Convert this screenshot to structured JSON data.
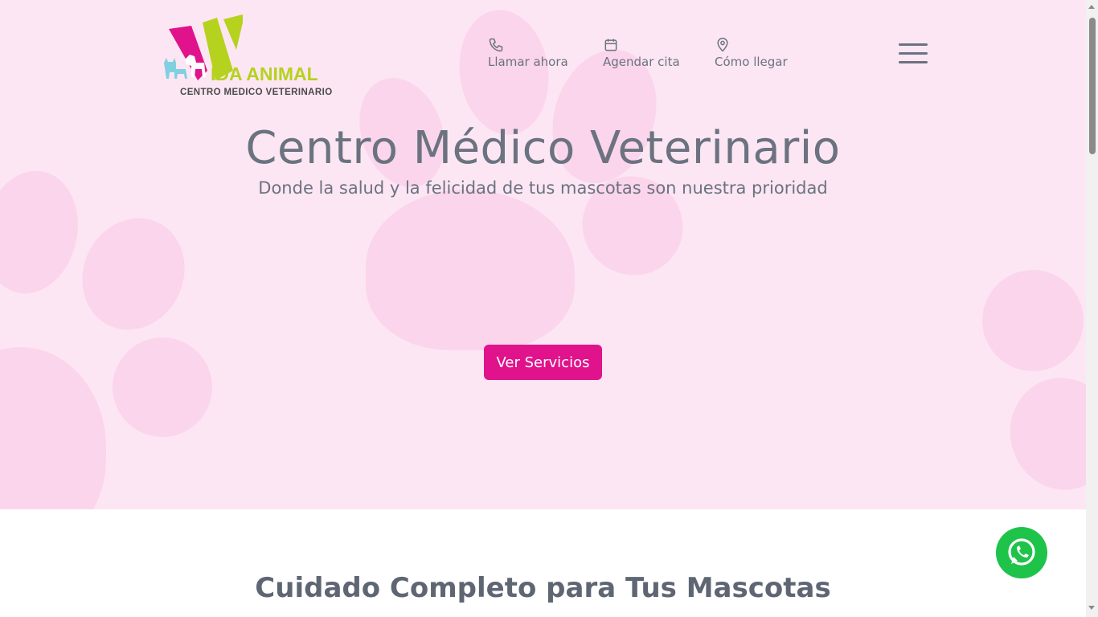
{
  "brand": {
    "logo_main": "IDA ANIMAL",
    "logo_sub": "CENTRO MEDICO VETERINARIO",
    "logo_icon": "dog-cat-logo-icon"
  },
  "nav": {
    "items": [
      {
        "label": "Llamar ahora",
        "icon": "phone-icon"
      },
      {
        "label": "Agendar cita",
        "icon": "calendar-icon"
      },
      {
        "label": "Cómo llegar",
        "icon": "location-pin-icon"
      }
    ],
    "menu_icon": "hamburger-menu-icon"
  },
  "hero": {
    "title": "Centro Médico Veterinario",
    "subtitle": "Donde la salud y la felicidad de tus mascotas son nuestra prioridad",
    "cta_label": "Ver Servicios"
  },
  "section": {
    "title": "Cuidado Completo para Tus Mascotas"
  },
  "floating": {
    "icon": "whatsapp-icon"
  },
  "colors": {
    "hero_bg": "#fde6f3",
    "paw": "#fbd5ec",
    "accent": "#e0138c",
    "text": "#6b7280",
    "logo_green": "#b5d21e",
    "logo_magenta": "#e0138c",
    "whatsapp": "#1ec34a"
  }
}
